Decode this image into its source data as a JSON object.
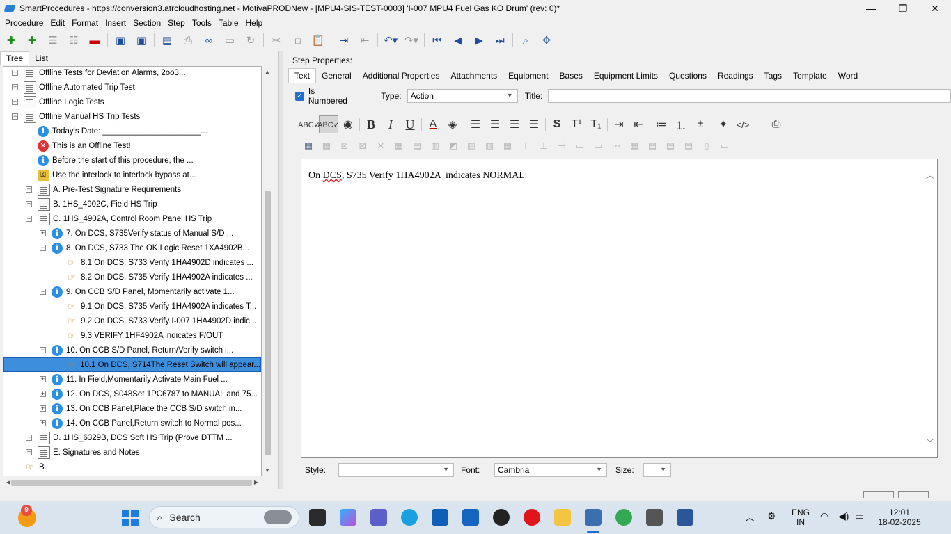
{
  "window": {
    "title": "SmartProcedures - https://conversion3.atrcloudhosting.net - MotivaPRODNew - [MPU4-SIS-TEST-0003] 'I-007 MPU4 Fuel Gas KO Drum' (rev: 0)*",
    "minimize": "—",
    "maximize": "❐",
    "close": "✕"
  },
  "menu": [
    "Procedure",
    "Edit",
    "Format",
    "Insert",
    "Section",
    "Step",
    "Tools",
    "Table",
    "Help"
  ],
  "left_tabs": [
    "Tree",
    "List"
  ],
  "tree": [
    {
      "indent": 0,
      "exp": "+",
      "icon": "doc",
      "label": "Offline Tests for Deviation Alarms, 2oo3..."
    },
    {
      "indent": 0,
      "exp": "+",
      "icon": "doc",
      "label": "Offline Automated Trip Test"
    },
    {
      "indent": 0,
      "exp": "+",
      "icon": "doc",
      "label": "Offline Logic Tests"
    },
    {
      "indent": 0,
      "exp": "−",
      "icon": "doc",
      "label": "Offline Manual HS Trip Tests"
    },
    {
      "indent": 1,
      "exp": "",
      "icon": "info",
      "label": "Today's Date: ______________________..."
    },
    {
      "indent": 1,
      "exp": "",
      "icon": "error",
      "label": "This is an Offline Test!"
    },
    {
      "indent": 1,
      "exp": "",
      "icon": "info",
      "label": "Before the start of this procedure, the ..."
    },
    {
      "indent": 1,
      "exp": "",
      "icon": "lock",
      "label": "Use the interlock to interlock bypass at..."
    },
    {
      "indent": 1,
      "exp": "+",
      "icon": "doc",
      "label": "A. Pre-Test Signature Requirements"
    },
    {
      "indent": 1,
      "exp": "+",
      "icon": "doc",
      "label": "B. 1HS_4902C, Field HS Trip"
    },
    {
      "indent": 1,
      "exp": "−",
      "icon": "doc",
      "label": "C. 1HS_4902A, Control Room Panel HS Trip"
    },
    {
      "indent": 2,
      "exp": "+",
      "icon": "info",
      "label": "7. On DCS, S735Verify status of Manual S/D ..."
    },
    {
      "indent": 2,
      "exp": "−",
      "icon": "info",
      "label": "8. On DCS, S733 The OK Logic Reset 1XA4902B..."
    },
    {
      "indent": 3,
      "exp": "",
      "icon": "hand",
      "label": "8.1 On DCS, S733 Verify 1HA4902D  indicates ..."
    },
    {
      "indent": 3,
      "exp": "",
      "icon": "hand",
      "label": "8.2 On DCS, S735 Verify 1HA4902A  indicates ..."
    },
    {
      "indent": 2,
      "exp": "−",
      "icon": "info",
      "label": "9. On CCB S/D Panel, Momentarily activate 1..."
    },
    {
      "indent": 3,
      "exp": "",
      "icon": "hand",
      "label": "9.1 On DCS, S735 Verify 1HA4902A indicates T..."
    },
    {
      "indent": 3,
      "exp": "",
      "icon": "hand",
      "label": "9.2 On DCS, S733 Verify I-007 1HA4902D indic..."
    },
    {
      "indent": 3,
      "exp": "",
      "icon": "hand",
      "label": "9.3 VERIFY 1HF4902A indicates F/OUT"
    },
    {
      "indent": 2,
      "exp": "−",
      "icon": "info",
      "label": "10. On CCB S/D Panel, Return/Verify switch i..."
    },
    {
      "indent": 3,
      "exp": "",
      "icon": "hand",
      "label": "10.1 On DCS, S714The Reset Switch will appear...",
      "selected": true
    },
    {
      "indent": 2,
      "exp": "+",
      "icon": "info",
      "label": "11. In Field,Momentarily Activate Main Fuel ..."
    },
    {
      "indent": 2,
      "exp": "+",
      "icon": "info",
      "label": "12. On DCS, S048Set 1PC6787 to MANUAL and 75..."
    },
    {
      "indent": 2,
      "exp": "+",
      "icon": "info",
      "label": "13. On CCB Panel,Place the CCB S/D switch in..."
    },
    {
      "indent": 2,
      "exp": "+",
      "icon": "info",
      "label": "14. On CCB Panel,Return switch to Normal pos..."
    },
    {
      "indent": 1,
      "exp": "+",
      "icon": "doc",
      "label": "D. 1HS_6329B, DCS Soft HS Trip (Prove DTTM ..."
    },
    {
      "indent": 1,
      "exp": "+",
      "icon": "doc",
      "label": "E. Signatures and Notes"
    },
    {
      "indent": 0,
      "exp": "",
      "icon": "hand",
      "label": "B."
    }
  ],
  "step_properties": {
    "heading": "Step Properties:",
    "tabs": [
      "Text",
      "General",
      "Additional Properties",
      "Attachments",
      "Equipment",
      "Bases",
      "Equipment Limits",
      "Questions",
      "Readings",
      "Tags",
      "Template",
      "Word"
    ],
    "is_numbered_label": "Is Numbered",
    "type_label": "Type:",
    "type_value": "Action",
    "title_label": "Title:",
    "title_value": ""
  },
  "editor": {
    "pre": "On ",
    "spell": "DCS",
    "post": ", S735 Verify 1HA4902A  indicates NORMAL"
  },
  "format_row": {
    "style_label": "Style:",
    "style_value": "",
    "font_label": "Font:",
    "font_value": "Cambria",
    "size_label": "Size:",
    "size_value": ""
  },
  "taskbar": {
    "weather_badge": "9",
    "search_label": "Search",
    "lang_line1": "ENG",
    "lang_line2": "IN",
    "time": "12:01",
    "date": "18-02-2025"
  }
}
